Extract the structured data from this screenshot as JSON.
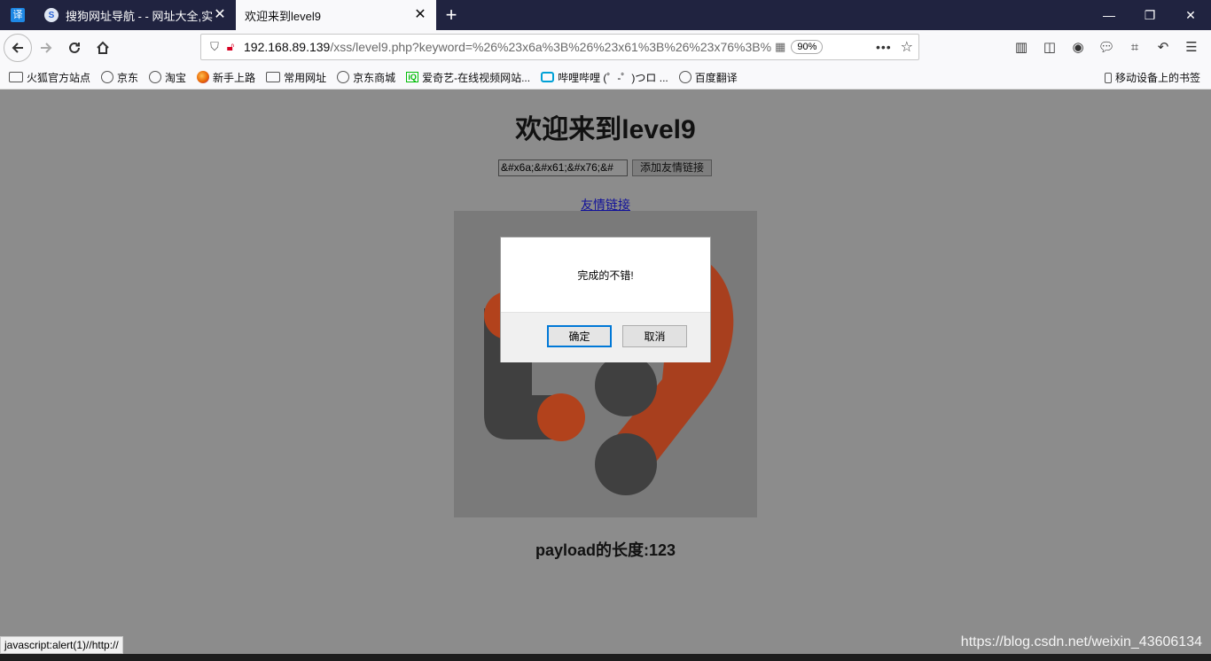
{
  "browser": {
    "app_icon_glyph": "译",
    "tabs": [
      {
        "label": "搜狗网址导航 - - 网址大全,实用",
        "favicon": "S"
      },
      {
        "label": "欢迎来到level9"
      }
    ],
    "new_tab_glyph": "+",
    "window_controls": {
      "minimize": "—",
      "restore": "❐",
      "close": "✕"
    },
    "url": {
      "host": "192.168.89.139",
      "path": "/xss/level9.php?keyword=%26%23x6a%3B%26%23x61%3B%26%23x76%3B%",
      "zoom": "90%"
    },
    "bookmarks": [
      {
        "label": "火狐官方站点",
        "icon": "folder-icon"
      },
      {
        "label": "京东",
        "icon": "globe-icon"
      },
      {
        "label": "淘宝",
        "icon": "globe-icon"
      },
      {
        "label": "新手上路",
        "icon": "firefox-icon"
      },
      {
        "label": "常用网址",
        "icon": "folder-icon"
      },
      {
        "label": "京东商城",
        "icon": "globe-icon"
      },
      {
        "label": "爱奇艺-在线视频网站...",
        "icon": "iqiyi-icon"
      },
      {
        "label": "哔哩哔哩 (゜-゜)つロ ...",
        "icon": "bilibili-icon"
      },
      {
        "label": "百度翻译",
        "icon": "globe-icon"
      }
    ],
    "mobile_bookmarks": "移动设备上的书签",
    "status_text": "javascript:alert(1)//http://"
  },
  "page": {
    "title": "欢迎来到level9",
    "keyword_value": "&#x6a;&#x61;&#x76;&#",
    "submit_label": "添加友情链接",
    "friend_link": "友情链接",
    "payload_length": "payload的长度:123",
    "colors": {
      "logo_orange": "#b2421c",
      "logo_dark": "#404040"
    }
  },
  "dialog": {
    "message": "完成的不错!",
    "ok_label": "确定",
    "cancel_label": "取消"
  },
  "watermark": "https://blog.csdn.net/weixin_43606134"
}
